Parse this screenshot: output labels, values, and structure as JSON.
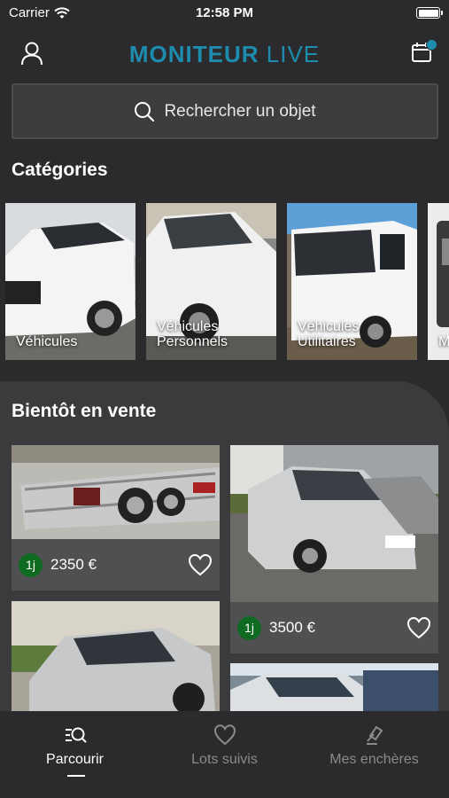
{
  "status_bar": {
    "carrier": "Carrier",
    "time": "12:58 PM"
  },
  "header": {
    "brand_bold": "MONITEUR",
    "brand_light": "LIVE",
    "accent_color": "#1d8cae"
  },
  "search": {
    "placeholder": "Rechercher un objet"
  },
  "categories": {
    "title": "Catégories",
    "items": [
      {
        "label": "Véhicules"
      },
      {
        "label": "Véhicules\nPersonnels"
      },
      {
        "label": "Véhicules\nUtilitaires"
      },
      {
        "label": "M"
      }
    ]
  },
  "upcoming": {
    "title": "Bientôt en vente",
    "lots": [
      {
        "days": "1j",
        "price": "2350 €"
      },
      {
        "days": "1j",
        "price": "3500 €"
      }
    ]
  },
  "tabs": [
    {
      "label": "Parcourir",
      "active": true
    },
    {
      "label": "Lots suivis",
      "active": false
    },
    {
      "label": "Mes enchères",
      "active": false
    }
  ]
}
